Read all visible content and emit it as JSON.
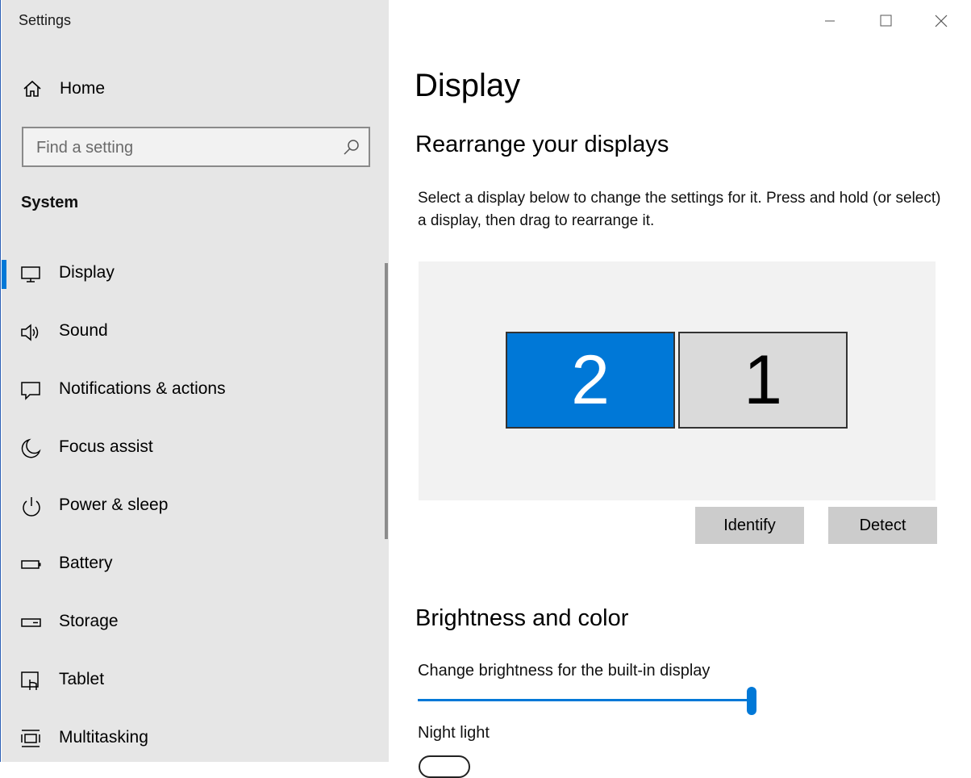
{
  "window": {
    "title": "Settings"
  },
  "sidebar": {
    "home_label": "Home",
    "search_placeholder": "Find a setting",
    "section": "System",
    "items": [
      {
        "label": "Display",
        "icon": "monitor-icon",
        "active": true
      },
      {
        "label": "Sound",
        "icon": "speaker-icon",
        "active": false
      },
      {
        "label": "Notifications & actions",
        "icon": "notification-icon",
        "active": false
      },
      {
        "label": "Focus assist",
        "icon": "moon-icon",
        "active": false
      },
      {
        "label": "Power & sleep",
        "icon": "power-icon",
        "active": false
      },
      {
        "label": "Battery",
        "icon": "battery-icon",
        "active": false
      },
      {
        "label": "Storage",
        "icon": "storage-icon",
        "active": false
      },
      {
        "label": "Tablet",
        "icon": "tablet-icon",
        "active": false
      },
      {
        "label": "Multitasking",
        "icon": "multitasking-icon",
        "active": false
      }
    ]
  },
  "main": {
    "title": "Display",
    "rearrange": {
      "heading": "Rearrange your displays",
      "description": "Select a display below to change the settings for it. Press and hold (or select) a display, then drag to rearrange it.",
      "monitors": [
        {
          "number": "2",
          "selected": true
        },
        {
          "number": "1",
          "selected": false
        }
      ],
      "identify_label": "Identify",
      "detect_label": "Detect"
    },
    "brightness": {
      "heading": "Brightness and color",
      "slider_label": "Change brightness for the built-in display",
      "level_percent": 100,
      "night_light_label": "Night light"
    }
  },
  "colors": {
    "accent": "#0078d7",
    "sidebar_bg": "#e6e6e6"
  }
}
